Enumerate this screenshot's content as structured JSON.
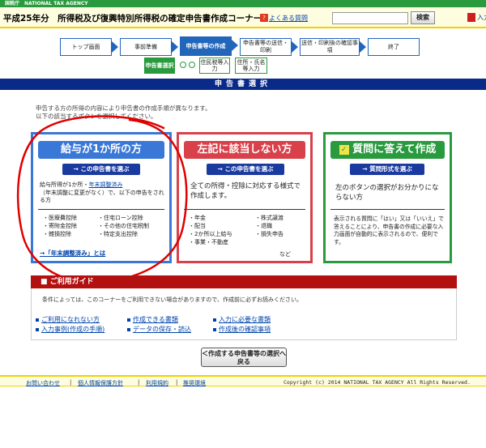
{
  "site": {
    "agency": "国税庁　NATIONAL TAX AGENCY"
  },
  "header": {
    "title": "平成25年分　所得税及び復興特別所得税の確定申告書作成コーナー",
    "faq": "よくある質問",
    "search_button": "検索",
    "manual": "入力例"
  },
  "steps": [
    {
      "label": "トップ画面"
    },
    {
      "label": "事前準備"
    },
    {
      "label": "申告書等の作成"
    },
    {
      "label": "申告書等の送信・印刷"
    },
    {
      "label": "送信・印刷後の確認事項"
    },
    {
      "label": "終了"
    }
  ],
  "substeps": [
    {
      "label": "申告書選択"
    },
    {
      "label": "住民税等入力"
    },
    {
      "label": "住所・氏名等入力"
    }
  ],
  "section_title": "申告書選択",
  "intro": [
    "申告する方の所得の内容により申告書の作成手順が異なります。",
    "以下の該当するボタンを選択してください。"
  ],
  "cards": {
    "salary": {
      "title": "給与が1か所の方",
      "button": "→ この申告書を選ぶ",
      "text1": "給与所得が1か所・",
      "text1_link": "年末調整済み",
      "text2": "（年末調整に変更がなく）で、以下の申告をされる方",
      "deductions": [
        "・医療費控除",
        "・住宅ローン控除",
        "・寄附金控除",
        "・その他の住宅税制",
        "・雑損控除",
        "・特定支出控除"
      ],
      "link": "→「年末調整済み」とは"
    },
    "other": {
      "title": "左記に該当しない方",
      "button": "→ この申告書を選ぶ",
      "text": "全ての所得・控除に対応する様式で作成します。",
      "items": [
        "・年金",
        "・株式譲渡",
        "・配当",
        "・退職",
        "・2か所以上給与",
        "・損失申告",
        "・事業・不動産"
      ],
      "etc": "など"
    },
    "question": {
      "title": "質問に答えて作成",
      "button": "→ 質問形式を選ぶ",
      "text": "左のボタンの選択がお分かりにならない方",
      "note": "表示される質問に「はい」又は「いいえ」で答えることにより、申告書の作成に必要な入力画面が自動的に表示されるので、便利です。"
    }
  },
  "guide": {
    "title": "■ ご利用ガイド",
    "note": "条件によっては、このコーナーをご利用できない場合がありますので、作成前に必ずお読みください。",
    "links": [
      "ご利用になれない方",
      "作成できる書類",
      "入力に必要な書類",
      "入力事例(作成の手順)",
      "データの保存・読込",
      "作成後の確認事項"
    ]
  },
  "back_button": "＜作成する申告書等の選択へ戻る",
  "footer": {
    "links": [
      "お問い合わせ",
      "個人情報保護方針",
      "利用規約",
      "推奨環境"
    ],
    "copyright": "Copyright (c) 2014 NATIONAL TAX AGENCY All Rights Reserved."
  },
  "colors": {
    "green": "#2a9a3e",
    "blue": "#2266bb",
    "navy": "#0a2a8a",
    "red": "#b31010",
    "annotation": "#e00000"
  }
}
